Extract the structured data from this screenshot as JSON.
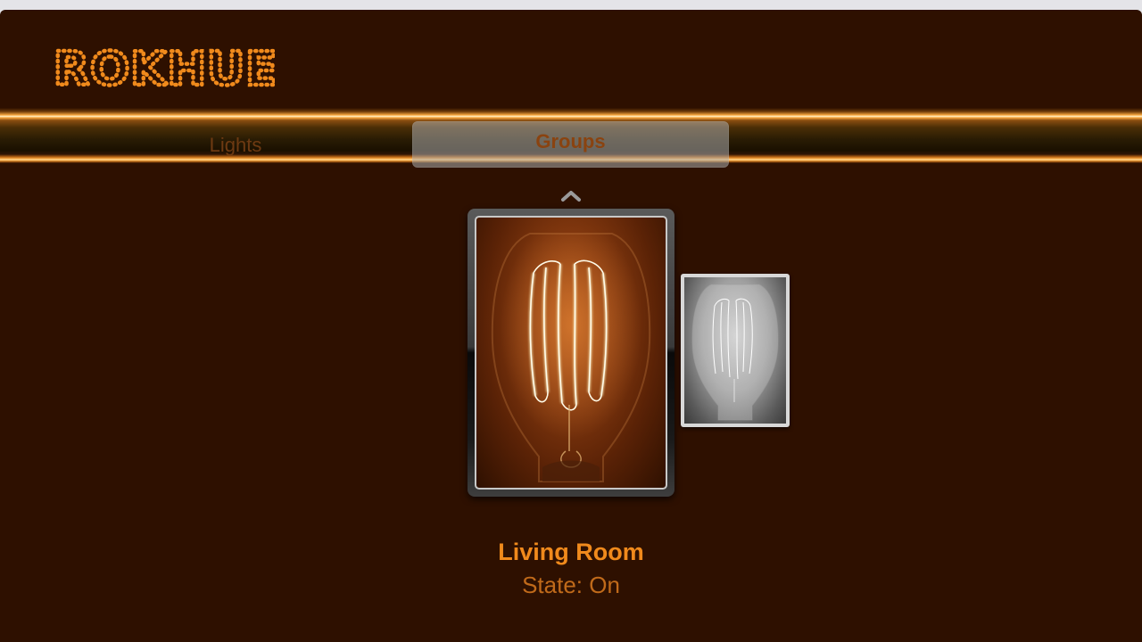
{
  "app": {
    "logo_text": "ROKHUE",
    "accent_color": "#f08a1c",
    "background_color": "#2e1000"
  },
  "nav": {
    "tabs": [
      {
        "label": "Lights",
        "selected": false
      },
      {
        "label": "Groups",
        "selected": true
      }
    ]
  },
  "carousel": {
    "up_indicator_icon": "chevron-up-icon",
    "items": [
      {
        "image": "edison-bulb-amber",
        "focused": true
      },
      {
        "image": "edison-bulb-grayscale",
        "focused": false
      }
    ]
  },
  "selected_item": {
    "title": "Living Room",
    "state_label": "State: ",
    "state_value": "On"
  }
}
